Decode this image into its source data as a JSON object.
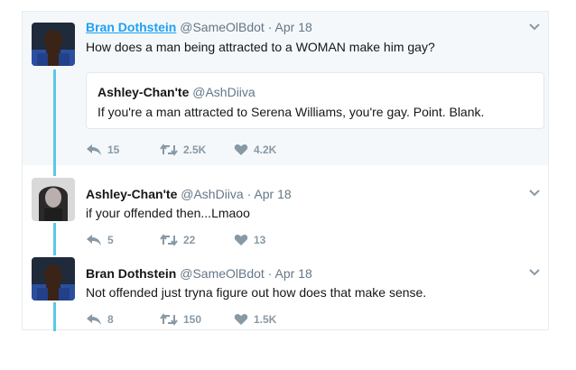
{
  "tweets": [
    {
      "name": "Bran Dothstein",
      "handle": "@SameOlBdot",
      "separator": "·",
      "date": "Apr 18",
      "text": "How does a man being attracted to a WOMAN make him gay?",
      "quote": {
        "name": "Ashley-Chan'te",
        "handle": "@AshDiiva",
        "text": "If you're a man attracted to Serena Williams, you're gay. Point. Blank."
      },
      "replies": "15",
      "retweets": "2.5K",
      "likes": "4.2K"
    },
    {
      "name": "Ashley-Chan'te",
      "handle": "@AshDiiva",
      "separator": "·",
      "date": "Apr 18",
      "text": "if your offended then...Lmaoo",
      "replies": "5",
      "retweets": "22",
      "likes": "13"
    },
    {
      "name": "Bran Dothstein",
      "handle": "@SameOlBdot",
      "separator": "·",
      "date": "Apr 18",
      "text": "Not offended just tryna figure out how does that make sense.",
      "replies": "8",
      "retweets": "150",
      "likes": "1.5K"
    }
  ],
  "icons": {
    "reply": "reply-icon",
    "retweet": "retweet-icon",
    "like": "heart-icon",
    "menu": "chevron-down-icon"
  },
  "colors": {
    "link": "#1da1f2",
    "thread_line": "#5ac8e6",
    "focus_bg": "#f5f8fa",
    "action_gray": "#8899a6"
  }
}
